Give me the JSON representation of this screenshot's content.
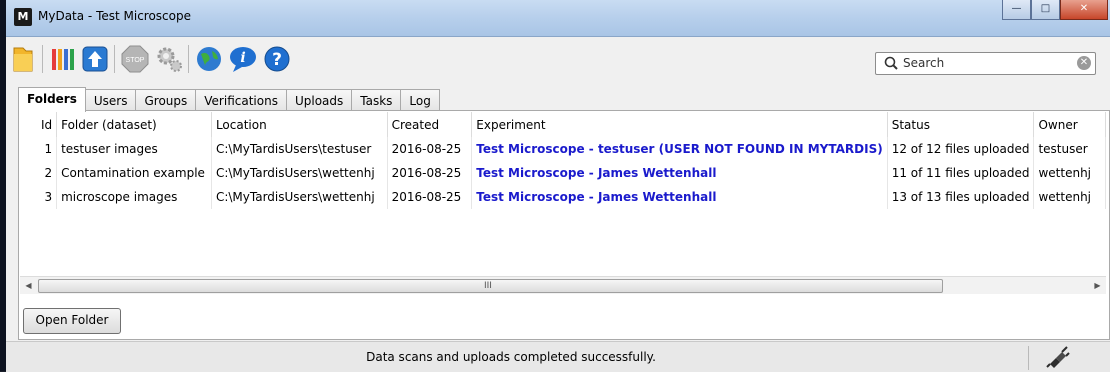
{
  "window": {
    "title": "MyData - Test Microscope",
    "app_icon_glyph": "M",
    "controls": {
      "minimize": "—",
      "maximize": "□",
      "close": "✕"
    }
  },
  "toolbar": {
    "icons": [
      "open-folder-icon",
      "test-run-icon",
      "upload-icon",
      "stop-icon",
      "settings-icon",
      "mytardis-globe-icon",
      "about-info-icon",
      "help-icon"
    ],
    "stop_label": "STOP"
  },
  "search": {
    "placeholder": "Search",
    "clear_glyph": "✕"
  },
  "tabs": [
    {
      "label": "Folders",
      "active": true
    },
    {
      "label": "Users"
    },
    {
      "label": "Groups"
    },
    {
      "label": "Verifications"
    },
    {
      "label": "Uploads"
    },
    {
      "label": "Tasks"
    },
    {
      "label": "Log"
    }
  ],
  "table": {
    "columns": [
      "Id",
      "Folder (dataset)",
      "Location",
      "Created",
      "Experiment",
      "Status",
      "Owner"
    ],
    "rows": [
      [
        "1",
        "testuser images",
        "C:\\MyTardisUsers\\testuser",
        "2016-08-25",
        "Test Microscope - testuser (USER NOT FOUND IN MYTARDIS)",
        "12 of 12 files uploaded",
        "testuser"
      ],
      [
        "2",
        "Contamination example",
        "C:\\MyTardisUsers\\wettenhj",
        "2016-08-25",
        "Test Microscope - James Wettenhall",
        "11 of 11 files uploaded",
        "wettenhj"
      ],
      [
        "3",
        "microscope images",
        "C:\\MyTardisUsers\\wettenhj",
        "2016-08-25",
        "Test Microscope - James Wettenhall",
        "13 of 13 files uploaded",
        "wettenhj"
      ]
    ]
  },
  "scrollbar": {
    "left_arrow": "◀",
    "right_arrow": "▶",
    "grip": "III"
  },
  "buttons": {
    "open_folder": "Open Folder"
  },
  "status": {
    "text": "Data scans and uploads completed successfully."
  },
  "colors": {
    "experiment_link": "#1a1acc",
    "titlebar": "#b8d0ec"
  }
}
